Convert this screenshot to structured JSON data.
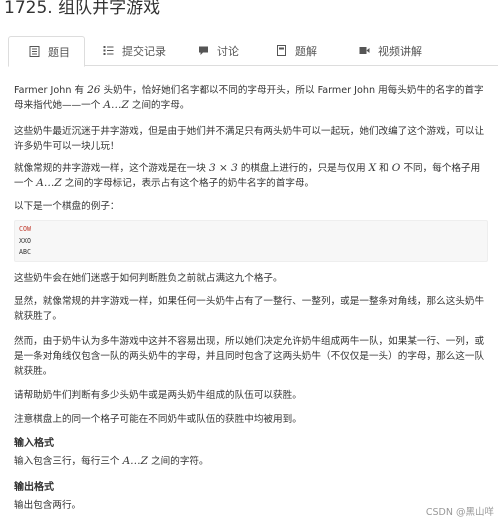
{
  "page": {
    "title": "1725. 组队井字游戏"
  },
  "tabs": [
    {
      "label": "题目",
      "icon": "document-icon"
    },
    {
      "label": "提交记录",
      "icon": "list-icon"
    },
    {
      "label": "讨论",
      "icon": "chat-icon"
    },
    {
      "label": "题解",
      "icon": "book-icon"
    },
    {
      "label": "视频讲解",
      "icon": "video-icon"
    }
  ],
  "problem": {
    "p1a": "Farmer John 有 ",
    "p1num": "26",
    "p1b": " 头奶牛，恰好她们名字都以不同的字母开头，所以 Farmer John 用每头奶牛的名字的首字母来指代她——一个 ",
    "p1m": "A…Z",
    "p1c": " 之间的字母。",
    "p2": "这些奶牛最近沉迷于井字游戏，但是由于她们并不满足只有两头奶牛可以一起玩，她们改编了这个游戏，可以让许多奶牛可以一块儿玩！",
    "p3a": "就像常规的井字游戏一样，这个游戏是在一块 ",
    "p3m": "3 × 3",
    "p3b": " 的棋盘上进行的，只是与仅用 ",
    "p3x": "X",
    "p3c": " 和 ",
    "p3o": "O",
    "p3d": " 不同，每个格子用一个 ",
    "p3m2": "A…Z",
    "p3e": " 之间的字母标记，表示占有这个格子的奶牛名字的首字母。",
    "p4": "以下是一个棋盘的例子：",
    "code": [
      "COW",
      "XXO",
      "ABC"
    ],
    "p5": "这些奶牛会在她们迷惑于如何判断胜负之前就占满这九个格子。",
    "p6": "显然，就像常规的井字游戏一样，如果任何一头奶牛占有了一整行、一整列，或是一整条对角线，那么这头奶牛就获胜了。",
    "p7": "然而，由于奶牛认为多牛游戏中这并不容易出现，所以她们决定允许奶牛组成两牛一队，如果某一行、一列，或是一条对角线仅包含一队的两头奶牛的字母，并且同时包含了这两头奶牛（不仅仅是一头）的字母，那么这一队就获胜。",
    "p8": "请帮助奶牛们判断有多少头奶牛或是两头奶牛组成的队伍可以获胜。",
    "p9": "注意棋盘上的同一个格子可能在不同奶牛或队伍的获胜中均被用到。",
    "input_heading": "输入格式",
    "input_a": "输入包含三行，每行三个 ",
    "input_m": "A…Z",
    "input_b": " 之间的字符。",
    "output_heading": "输出格式",
    "output": "输出包含两行。"
  },
  "footer": {
    "watermark": "CSDN @黑山咩"
  }
}
